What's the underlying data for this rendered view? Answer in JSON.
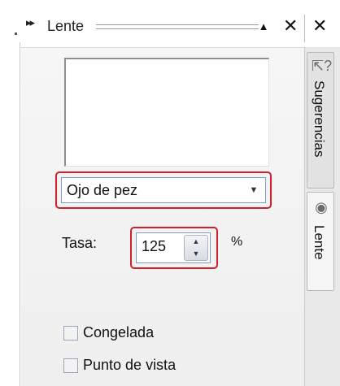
{
  "window": {
    "title": "Lente",
    "title_grip_icon": "double-arrow-icon",
    "actions": {
      "collapse_icon": "triangle-up-icon",
      "close_glyph": "✕",
      "close_glyph_2": "✕"
    }
  },
  "lens": {
    "type_select": {
      "value": "Ojo de pez",
      "arrow_icon": "chevron-down-icon"
    },
    "rate": {
      "label": "Tasa:",
      "value": "125",
      "unit": "%"
    },
    "checkboxes": [
      {
        "label": "Congelada",
        "checked": false
      },
      {
        "label": "Punto de vista",
        "checked": false
      }
    ]
  },
  "tabs": [
    {
      "label": "Sugerencias",
      "icon": "help-cursor-icon",
      "active": false
    },
    {
      "label": "Lente",
      "icon": "lens-icon",
      "active": true
    }
  ],
  "colors": {
    "highlight": "#d0202a",
    "input_border": "#7f9db9",
    "panel_bg": "#f4f4f4"
  }
}
